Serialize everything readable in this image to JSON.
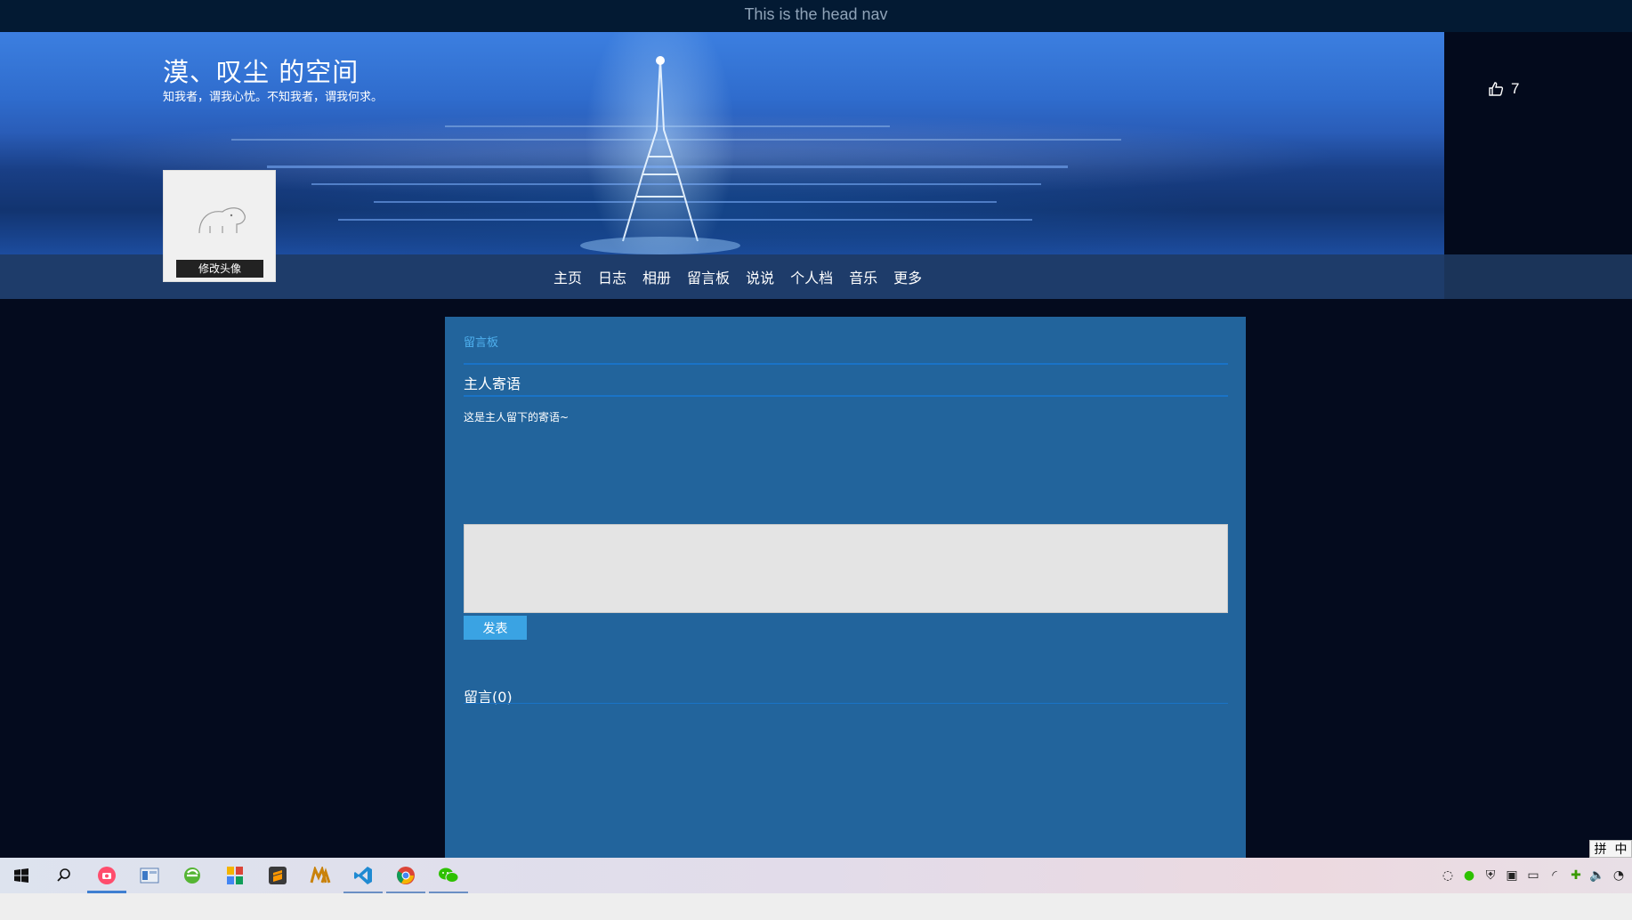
{
  "head_nav": {
    "text": "This is the head nav"
  },
  "header": {
    "title": "漠、叹尘 的空间",
    "motto": "知我者，谓我心忧。不知我者，谓我何求。",
    "likes": "7",
    "avatar_button": "修改头像"
  },
  "nav": {
    "items": [
      "主页",
      "日志",
      "相册",
      "留言板",
      "说说",
      "个人档",
      "音乐",
      "更多"
    ]
  },
  "board": {
    "breadcrumb": "留言板",
    "host_title": "主人寄语",
    "host_message": "这是主人留下的寄语~",
    "input_value": "",
    "post_button": "发表",
    "comments_title": "留言(0)"
  },
  "ime": {
    "left": "拼",
    "right": "中"
  },
  "taskbar": {
    "apps": [
      "windows-start",
      "search",
      "screen-recorder",
      "file-explorer",
      "ie-browser",
      "app-store",
      "sublime-text",
      "mx-app",
      "vscode",
      "chrome",
      "wechat"
    ],
    "active": "screen-recorder",
    "open": [
      "vscode",
      "chrome",
      "wechat"
    ]
  },
  "colors": {
    "page_bg": "#040b1e",
    "panel": "#22649c",
    "accent": "#3aa3e3",
    "rule": "#1a73c7",
    "breadcrumb": "#4fb0ee"
  }
}
